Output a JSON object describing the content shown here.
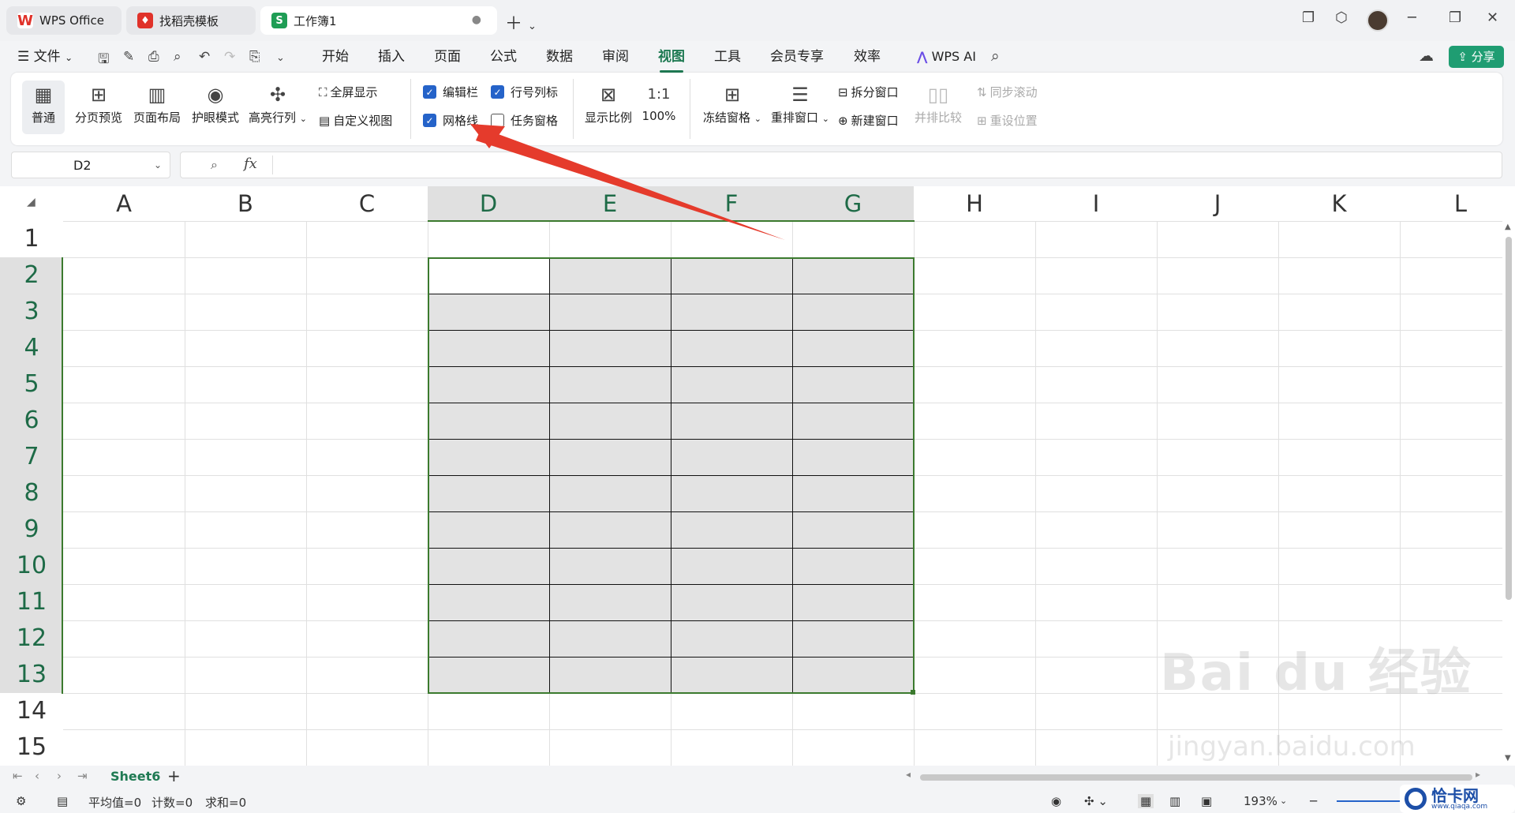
{
  "tabs": [
    {
      "label": "WPS Office",
      "icon": "wps-logo-icon"
    },
    {
      "label": "找稻壳模板",
      "icon": "docer-logo-icon"
    },
    {
      "label": "工作簿1",
      "icon": "spreadsheet-icon",
      "logo_letter": "S",
      "unsaved_mark": "●"
    }
  ],
  "menu": {
    "file": "文件",
    "items": [
      "开始",
      "插入",
      "页面",
      "公式",
      "数据",
      "审阅",
      "视图",
      "工具",
      "会员专享",
      "效率"
    ],
    "active": "视图",
    "wps_ai": "WPS AI",
    "share": "分享"
  },
  "ribbon": {
    "normal": "普通",
    "page_break_preview": "分页预览",
    "page_layout": "页面布局",
    "eye_protection": "护眼模式",
    "highlight_rowcol": "高亮行列",
    "fullscreen": "全屏显示",
    "custom_view": "自定义视图",
    "formula_bar_cb": "编辑栏",
    "headings_cb": "行号列标",
    "gridlines_cb": "网格线",
    "task_pane_cb": "任务窗格",
    "zoom": "显示比例",
    "zoom100": "100%",
    "freeze": "冻结窗格",
    "arrange": "重排窗口",
    "split": "拆分窗口",
    "new_window": "新建窗口",
    "side_by_side": "并排比较",
    "sync_scroll": "同步滚动",
    "reset_position": "重设位置"
  },
  "checkboxes": {
    "formula_bar": true,
    "headings": true,
    "gridlines": true,
    "task_pane": false
  },
  "namebox": "D2",
  "fx": "fx",
  "columns": [
    "A",
    "B",
    "C",
    "D",
    "E",
    "F",
    "G",
    "H",
    "I",
    "J",
    "K",
    "L"
  ],
  "rows": [
    "1",
    "2",
    "3",
    "4",
    "5",
    "6",
    "7",
    "8",
    "9",
    "10",
    "11",
    "12",
    "13",
    "14",
    "15"
  ],
  "selected_columns": [
    "D",
    "E",
    "F",
    "G"
  ],
  "selected_rows": [
    "2",
    "3",
    "4",
    "5",
    "6",
    "7",
    "8",
    "9",
    "10",
    "11",
    "12",
    "13"
  ],
  "sheet": {
    "name": "Sheet6",
    "add": "+"
  },
  "status": {
    "avg": "平均值=0",
    "count": "计数=0",
    "sum": "求和=0",
    "zoom": "193%"
  },
  "watermark": {
    "baidu": "Bai du 经验",
    "url": "jingyan.baidu.com",
    "corner": "恰卡网",
    "corner_url": "www.qiaqa.com"
  },
  "colors": {
    "accent": "#1f7a53",
    "selection_border": "#3b7a2e",
    "annotation_arrow": "#e53b2c",
    "checkbox": "#2563c9"
  }
}
